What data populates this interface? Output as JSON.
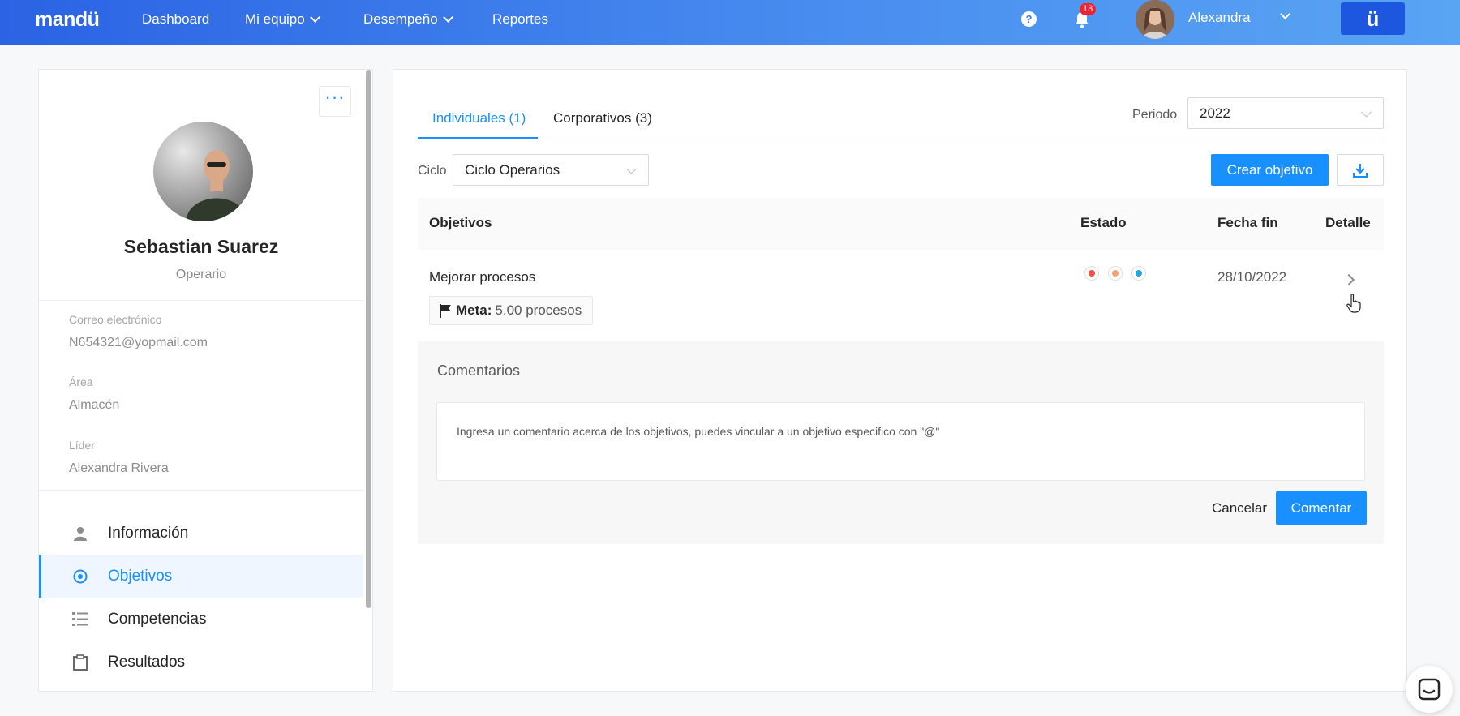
{
  "nav": {
    "logo": "mandü",
    "items": [
      {
        "label": "Dashboard"
      },
      {
        "label": "Mi equipo"
      },
      {
        "label": "Desempeño"
      },
      {
        "label": "Reportes"
      }
    ],
    "notifications_count": "13",
    "user_name": "Alexandra",
    "brand_button": "ü"
  },
  "profile": {
    "name": "Sebastian Suarez",
    "role": "Operario",
    "fields": [
      {
        "label": "Correo electrónico",
        "value": "N654321@yopmail.com"
      },
      {
        "label": "Área",
        "value": "Almacén"
      },
      {
        "label": "Líder",
        "value": "Alexandra Rivera"
      }
    ],
    "menu": [
      {
        "label": "Información",
        "icon": "user-icon",
        "active": false
      },
      {
        "label": "Objetivos",
        "icon": "target-icon",
        "active": true
      },
      {
        "label": "Competencias",
        "icon": "list-icon",
        "active": false
      },
      {
        "label": "Resultados",
        "icon": "clipboard-icon",
        "active": false
      }
    ]
  },
  "main": {
    "tabs": [
      {
        "label": "Individuales (1)",
        "active": true
      },
      {
        "label": "Corporativos (3)",
        "active": false
      }
    ],
    "period_label": "Periodo",
    "period_value": "2022",
    "cycle_label": "Ciclo",
    "cycle_value": "Ciclo Operarios",
    "create_button": "Crear objetivo",
    "table": {
      "headers": {
        "objectives": "Objetivos",
        "status": "Estado",
        "end_date": "Fecha fin",
        "detail": "Detalle"
      },
      "rows": [
        {
          "title": "Mejorar procesos",
          "meta_label": "Meta:",
          "meta_value": "5.00 procesos",
          "status_colors": [
            "#f5504a",
            "#f7a36b",
            "#22a6e0"
          ],
          "end_date": "28/10/2022"
        }
      ]
    },
    "comments": {
      "title": "Comentarios",
      "placeholder": "Ingresa un comentario acerca de los objetivos, puedes vincular a un objetivo especifico con \"@\"",
      "cancel_label": "Cancelar",
      "submit_label": "Comentar"
    }
  },
  "colors": {
    "primary": "#1890ff",
    "nav_gradient_start": "#2b63e4",
    "nav_gradient_end": "#59a4f3"
  }
}
